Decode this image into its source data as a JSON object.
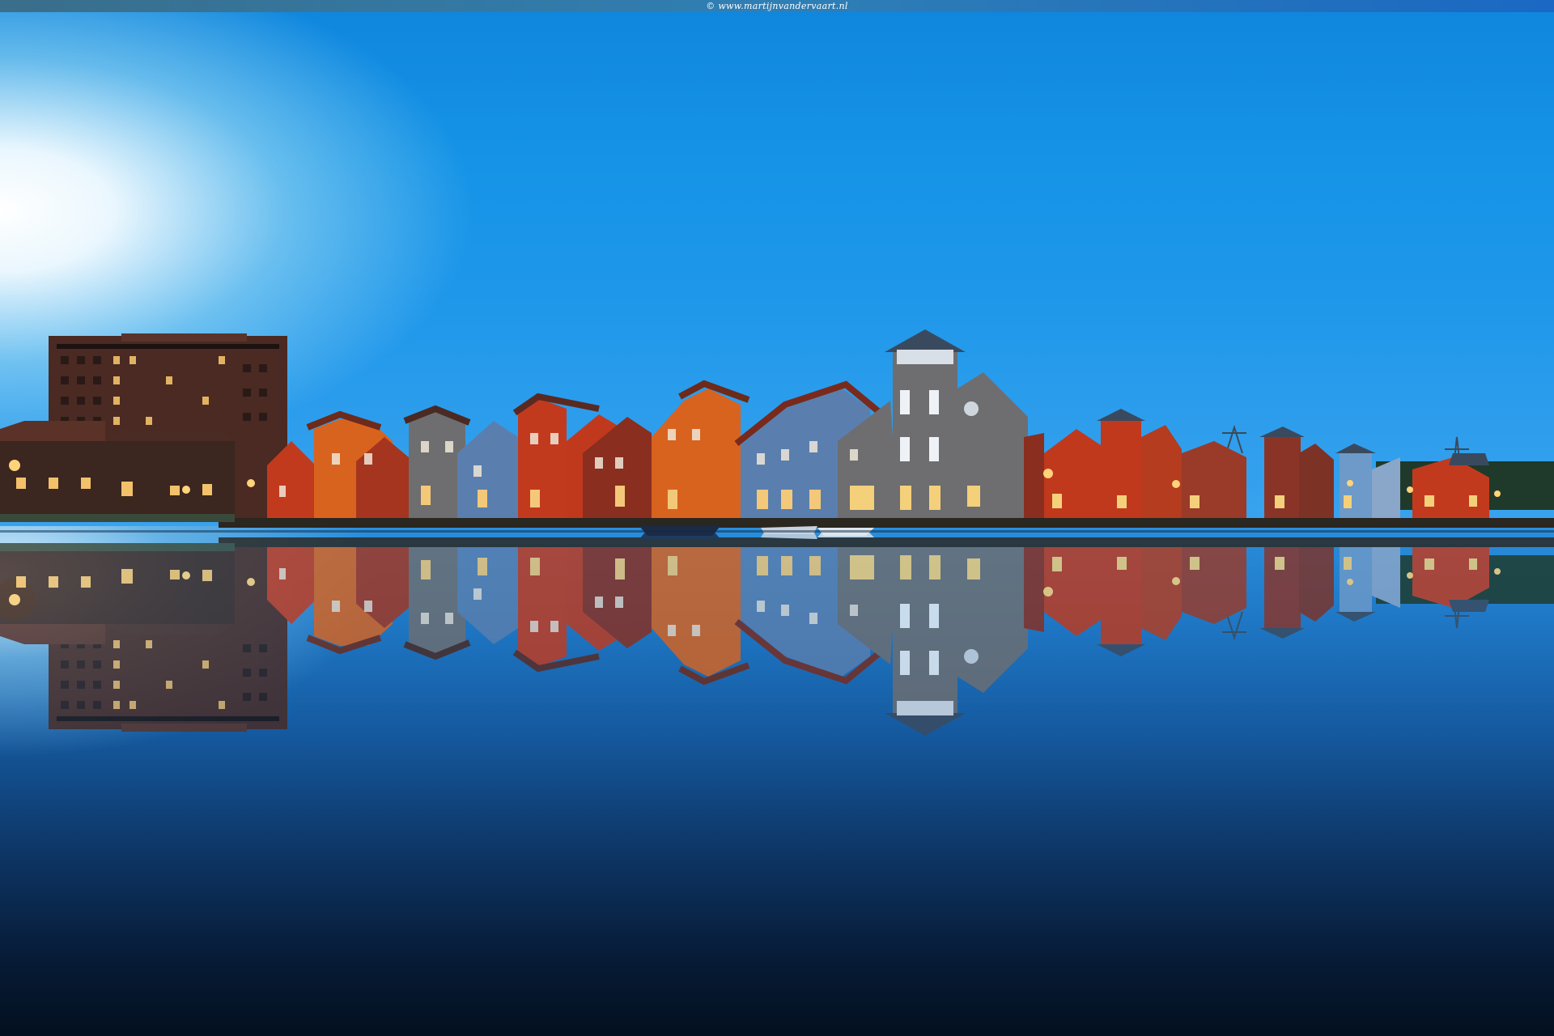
{
  "credit": "© www.martijnvandervaart.nl",
  "colors": {
    "sky_top": "#0f86dd",
    "sky_glow": "#f5fcff",
    "water_deep": "#071b36",
    "lamp_glow": "#ffb84a",
    "house_orange": "#d8631f",
    "house_red": "#c23a1e",
    "house_blue": "#5a7fae",
    "house_grey": "#6e6e70",
    "apartment_brown": "#4a2a22"
  }
}
